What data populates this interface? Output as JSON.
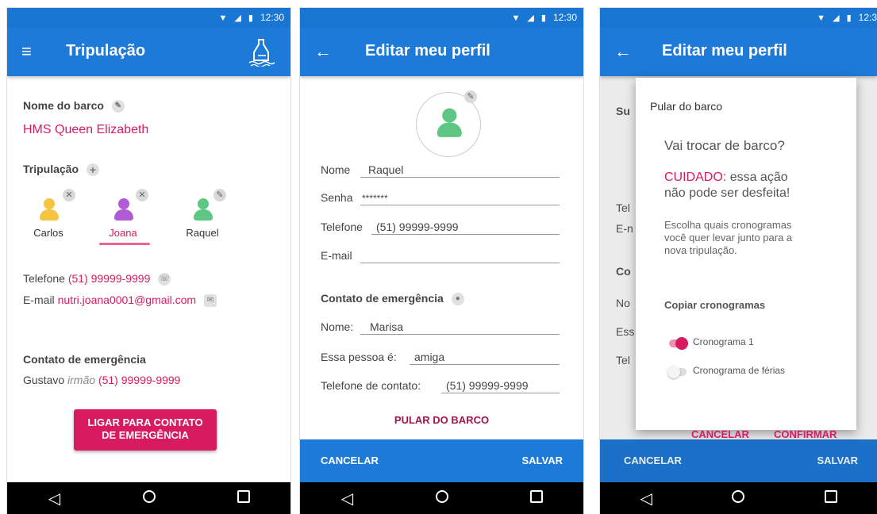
{
  "status_bar": {
    "time": "12:30",
    "time_cut": "12:3"
  },
  "screen1": {
    "title": "Tripulação",
    "boat_label": "Nome do barco",
    "boat_name": "HMS Queen Elizabeth",
    "crew_label": "Tripulação",
    "members": [
      {
        "name": "Carlos",
        "color": "#f5c542"
      },
      {
        "name": "Joana",
        "color": "#b05cd6"
      },
      {
        "name": "Raquel",
        "color": "#5ec784"
      }
    ],
    "phone_label": "Telefone",
    "phone_value": "(51) 99999-9999",
    "email_label": "E-mail",
    "email_value": "nutri.joana0001@gmail.com",
    "emergency_label": "Contato de emergência",
    "emergency_name": "Gustavo",
    "emergency_relation": "irmão",
    "emergency_phone": "(51) 99999-9999",
    "call_button": "LIGAR PARA CONTATO DE EMERGÊNCIA"
  },
  "screen2": {
    "title": "Editar meu perfil",
    "fields": [
      {
        "label": "Nome",
        "value": "Raquel"
      },
      {
        "label": "Senha",
        "value": "*******"
      },
      {
        "label": "Telefone",
        "value": "(51) 99999-9999"
      },
      {
        "label": "E-mail",
        "value": ""
      }
    ],
    "emergency_label": "Contato de emergência",
    "emergency_fields": [
      {
        "label": "Nome:",
        "value": "Marisa"
      },
      {
        "label": "Essa pessoa é:",
        "value": "amiga"
      },
      {
        "label": "Telefone de contato:",
        "value": "(51) 99999-9999"
      }
    ],
    "jump_button": "PULAR DO BARCO",
    "cancel": "CANCELAR",
    "save": "SALVAR"
  },
  "screen3": {
    "title": "Editar meu perfil",
    "bg_fragments": [
      "Su",
      "Tel",
      "E-n",
      "Co",
      "No",
      "Ess",
      "Tel"
    ],
    "dialog": {
      "title": "Pular do barco",
      "question": "Vai trocar de barco?",
      "warning_strong": "CUIDADO:",
      "warning_rest_1": "essa ação",
      "warning_rest_2": "não pode ser desfeita!",
      "desc_1": "Escolha quais cronogramas",
      "desc_2": "você quer levar junto para a",
      "desc_3": "nova tripulação.",
      "copy_label": "Copiar cronogramas",
      "options": [
        {
          "label": "Cronograma 1",
          "on": true
        },
        {
          "label": "Cronograma de férias",
          "on": false
        }
      ],
      "cancel": "CANCELAR",
      "confirm": "CONFIRMAR"
    },
    "cancel": "CANCELAR",
    "save": "SALVAR"
  }
}
